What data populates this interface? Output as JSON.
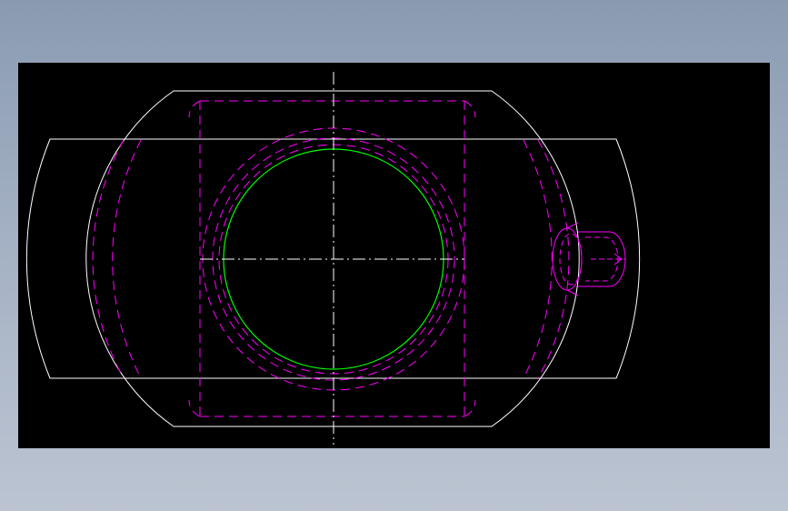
{
  "app": {
    "background_gradient": [
      "#8a9bb1",
      "#bcc4d2"
    ]
  },
  "viewport": {
    "background_color": "#000000"
  },
  "drawing": {
    "layer_colors": {
      "outline": "#ffffff",
      "hidden": "#ff00ff",
      "bore": "#00ff00",
      "centerline": "#ffffff"
    },
    "entities": [
      "outer-profile",
      "flange-profile",
      "hidden-body",
      "hidden-rings",
      "bore-circle",
      "centerlines",
      "grease-fitting"
    ]
  }
}
